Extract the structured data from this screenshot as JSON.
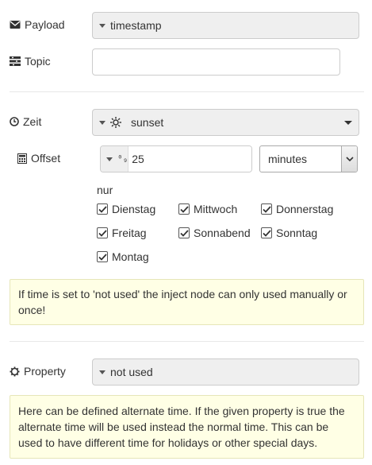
{
  "payload": {
    "label": "Payload",
    "type_value": "timestamp"
  },
  "topic": {
    "label": "Topic",
    "value": ""
  },
  "zeit": {
    "label": "Zeit",
    "value": "sunset"
  },
  "offset": {
    "label": "Offset",
    "value": "25",
    "unit": "minutes"
  },
  "days": {
    "heading": "nur",
    "items": [
      {
        "label": "Dienstag",
        "checked": true
      },
      {
        "label": "Mittwoch",
        "checked": true
      },
      {
        "label": "Donnerstag",
        "checked": true
      },
      {
        "label": "Freitag",
        "checked": true
      },
      {
        "label": "Sonnabend",
        "checked": true
      },
      {
        "label": "Sonntag",
        "checked": true
      },
      {
        "label": "Montag",
        "checked": true
      }
    ]
  },
  "tip1": "If time is set to 'not used' the inject node can only used manually or once!",
  "property": {
    "label": "Property",
    "value": "not used"
  },
  "tip2": "Here can be defined alternate time. If the given property is true the alternate time will be used instead the normal time. This can be used to have different time for holidays or other special days.",
  "colors": {
    "tip_bg": "#ffffe5",
    "field_bg": "#efefef",
    "border": "#cccccc"
  }
}
